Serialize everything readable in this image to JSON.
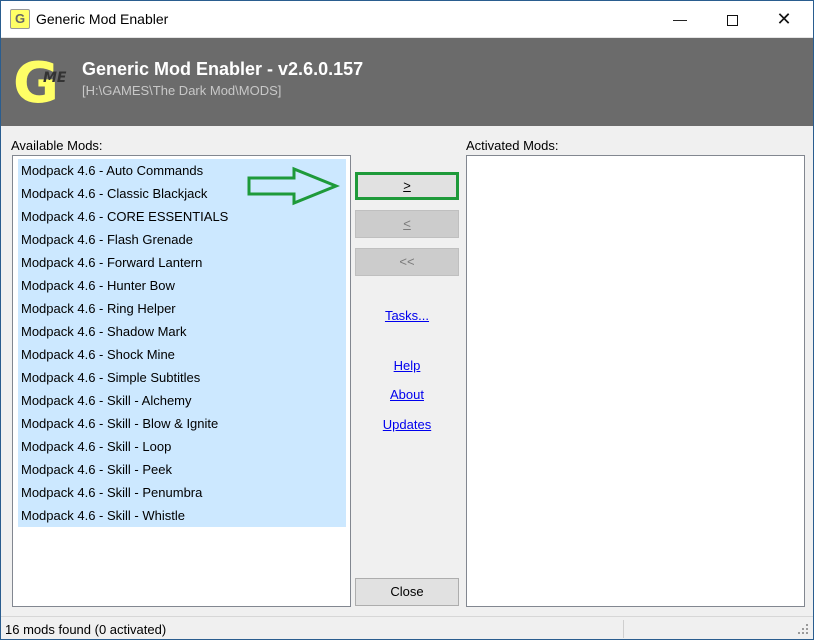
{
  "window": {
    "title": "Generic Mod Enabler",
    "controls": {
      "minimize": "—",
      "close": "✕"
    }
  },
  "header": {
    "logo_letter": "G",
    "logo_badge": "ME",
    "title": "Generic Mod Enabler - v2.6.0.157",
    "path": "[H:\\GAMES\\The Dark Mod\\MODS]"
  },
  "available": {
    "label": "Available Mods:",
    "items": [
      "Modpack 4.6 - Auto Commands",
      "Modpack 4.6 - Classic Blackjack",
      "Modpack 4.6 - CORE ESSENTIALS",
      "Modpack 4.6 - Flash Grenade",
      "Modpack 4.6 - Forward Lantern",
      "Modpack 4.6 - Hunter Bow",
      "Modpack 4.6 - Ring Helper",
      "Modpack 4.6 - Shadow Mark",
      "Modpack 4.6 - Shock Mine",
      "Modpack 4.6 - Simple Subtitles",
      "Modpack 4.6 - Skill - Alchemy",
      "Modpack 4.6 - Skill - Blow & Ignite",
      "Modpack 4.6 - Skill - Loop",
      "Modpack 4.6 - Skill - Peek",
      "Modpack 4.6 - Skill - Penumbra",
      "Modpack 4.6 - Skill - Whistle"
    ]
  },
  "activated": {
    "label": "Activated Mods:",
    "items": []
  },
  "buttons": {
    "add": ">",
    "remove": "<",
    "remove_all": "<<",
    "tasks": "Tasks...",
    "help": "Help",
    "about": "About",
    "updates": "Updates",
    "close": "Close"
  },
  "annotation": {
    "arrow_color": "#1e9a3a"
  },
  "status": {
    "text": "16 mods found (0 activated)"
  },
  "colors": {
    "header_bg": "#6b6b6b",
    "selection_bg": "#cce8ff",
    "link": "#0000ee",
    "logo_yellow": "#ffff66"
  }
}
